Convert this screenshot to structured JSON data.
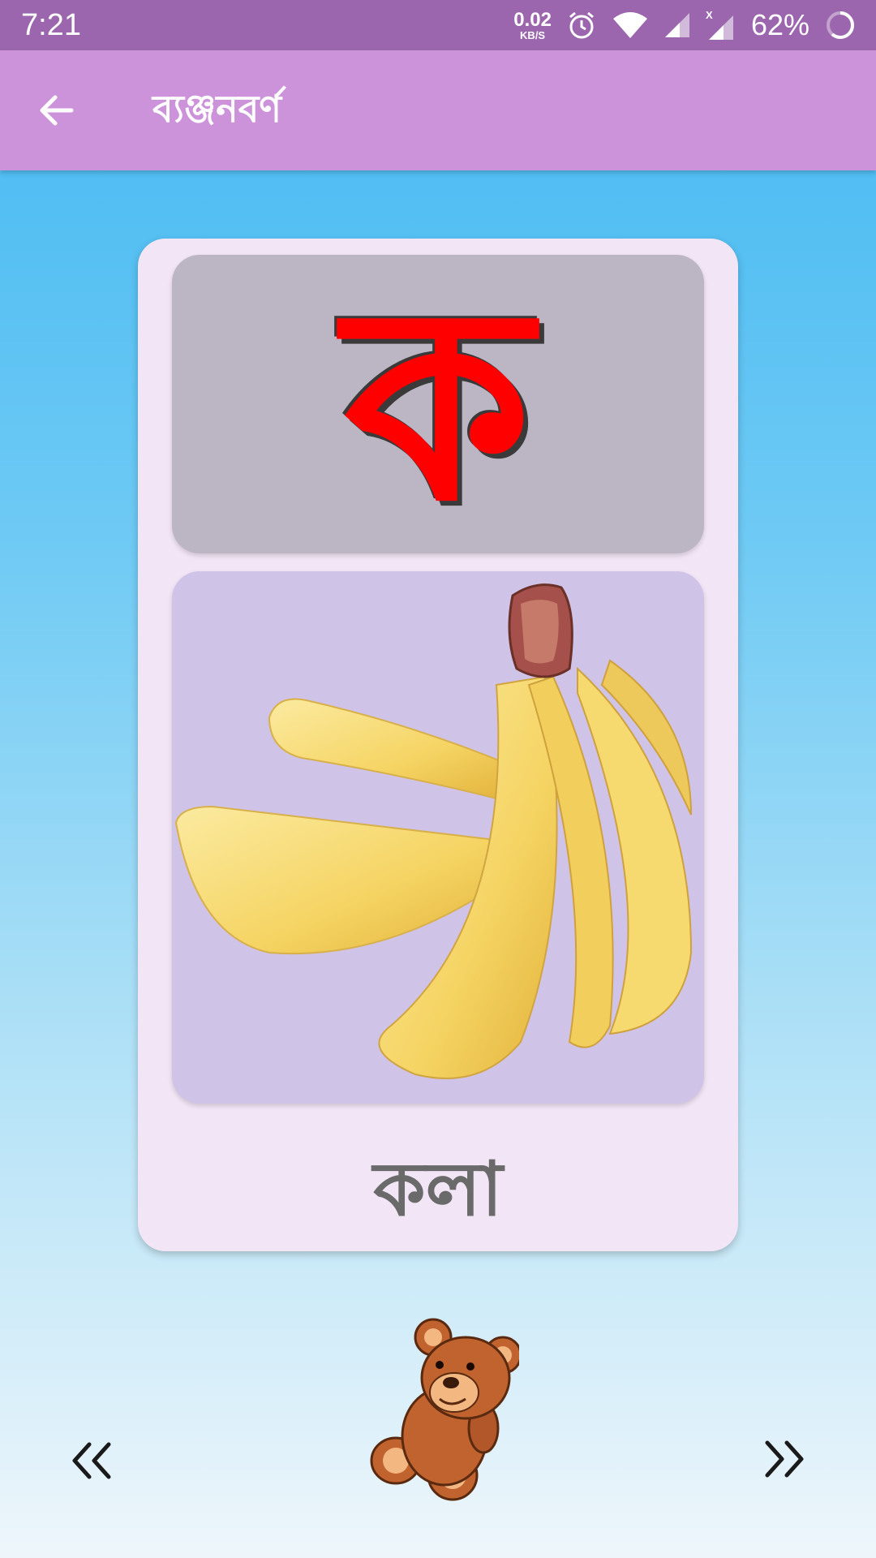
{
  "status_bar": {
    "time": "7:21",
    "net_speed_value": "0.02",
    "net_speed_unit": "KB/S",
    "battery": "62%",
    "icons": [
      "alarm-icon",
      "wifi-icon",
      "signal-icon",
      "signal-x-icon",
      "battery-ring-icon"
    ]
  },
  "app_bar": {
    "title": "ব্যঞ্জনবর্ণ",
    "back_icon": "arrow-left-icon"
  },
  "card": {
    "letter": "ক",
    "letter_color": "#ff0000",
    "image": "banana-image",
    "word": "কলা"
  },
  "navigation": {
    "prev_icon": "double-chevron-left-icon",
    "next_icon": "double-chevron-right-icon",
    "mascot": "teddy-bear-icon"
  },
  "colors": {
    "status_bar": "#9b66ad",
    "app_bar": "#cd93da",
    "card_bg": "#f2e5f6",
    "letter_panel": "#bcb5c3",
    "image_panel": "#d0c3e8",
    "word_text": "#6a6a6a"
  }
}
